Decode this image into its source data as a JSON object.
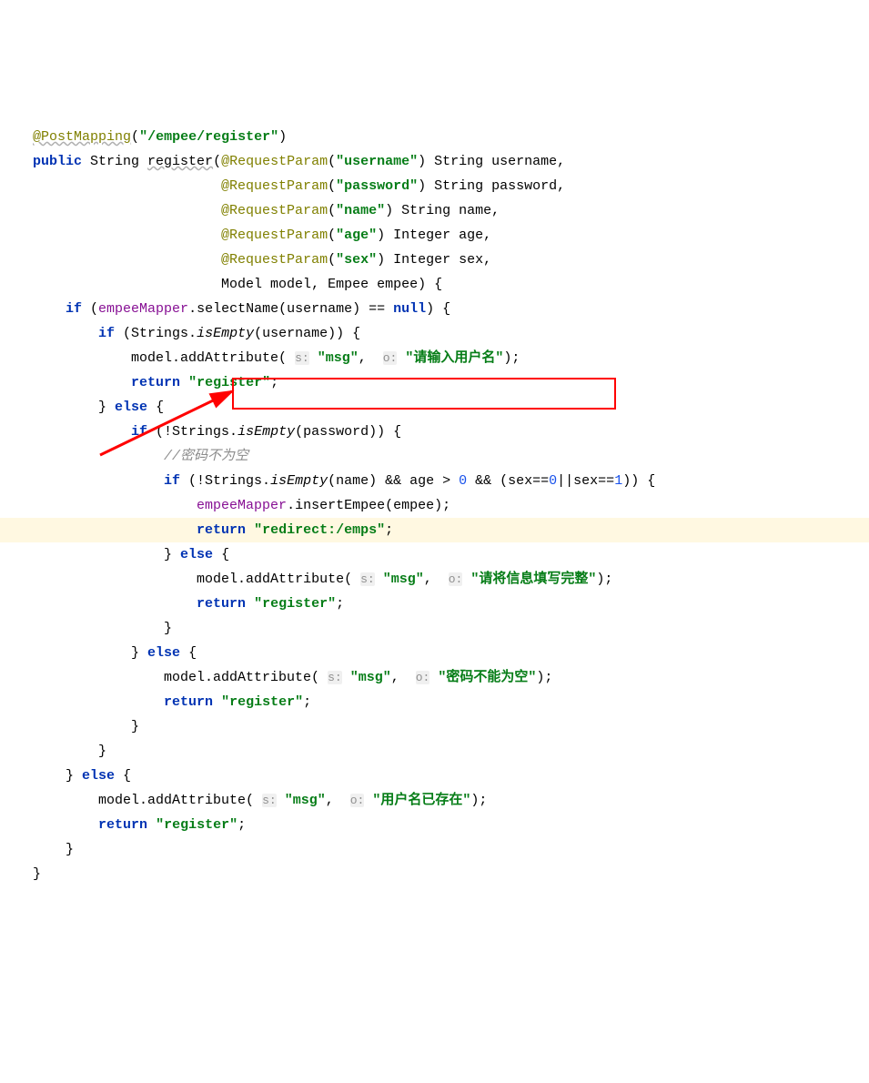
{
  "line1": {
    "ann": "@PostMapping",
    "p1": "(",
    "s": "\"/empee/register\"",
    "p2": ")"
  },
  "line2": {
    "kw1": "public",
    "sp1": " String ",
    "m": "register",
    "p1": "(",
    "ann": "@RequestParam",
    "p2": "(",
    "s": "\"username\"",
    "p3": ") String username,"
  },
  "line3": {
    "ann": "@RequestParam",
    "p1": "(",
    "s": "\"password\"",
    "p2": ") String password,"
  },
  "line4": {
    "ann": "@RequestParam",
    "p1": "(",
    "s": "\"name\"",
    "p2": ") String name,"
  },
  "line5": {
    "ann": "@RequestParam",
    "p1": "(",
    "s": "\"age\"",
    "p2": ") Integer age,"
  },
  "line6": {
    "ann": "@RequestParam",
    "p1": "(",
    "s": "\"sex\"",
    "p2": ") Integer sex,"
  },
  "line7": {
    "txt": "Model model, Empee empee) {"
  },
  "line8": {
    "kw": "if",
    "p1": " (",
    "f": "empeeMapper",
    "p2": ".selectName(username) == ",
    "kw2": "null",
    "p3": ") {"
  },
  "line9": {
    "kw": "if",
    "p1": " (Strings.",
    "m": "isEmpty",
    "p2": "(username)) {"
  },
  "line10": {
    "p1": "model.addAttribute( ",
    "h1": "s:",
    "sp1": " ",
    "s1": "\"msg\"",
    "p2": ",  ",
    "h2": "o:",
    "sp2": " ",
    "s2": "\"请输入用户名\"",
    "p3": ");"
  },
  "line11": {
    "kw": "return",
    "sp": " ",
    "s": "\"register\"",
    "p": ";"
  },
  "line12": {
    "p": "} ",
    "kw": "else",
    "p2": " {"
  },
  "line13": {
    "kw": "if",
    "p1": " (!Strings.",
    "m": "isEmpty",
    "p2": "(password)) {"
  },
  "line14": {
    "c": "//密码不为空"
  },
  "line15": {
    "kw": "if",
    "p1": " (!Strings.",
    "m": "isEmpty",
    "p2": "(name) && age > ",
    "n1": "0",
    "p3": " && (sex==",
    "n2": "0",
    "p4": "||sex==",
    "n3": "1",
    "p5": ")) {"
  },
  "line16": {
    "f": "empeeMapper",
    "p": ".insertEmpee(empee);"
  },
  "line17": {
    "kw": "return",
    "sp": " ",
    "s": "\"redirect:/emps\"",
    "p": ";"
  },
  "line18": {
    "p": "} ",
    "kw": "else",
    "p2": " {"
  },
  "line19": {
    "p1": "model.addAttribute( ",
    "h1": "s:",
    "sp1": " ",
    "s1": "\"msg\"",
    "p2": ",  ",
    "h2": "o:",
    "sp2": " ",
    "s2": "\"请将信息填写完整\"",
    "p3": ");"
  },
  "line20": {
    "kw": "return",
    "sp": " ",
    "s": "\"register\"",
    "p": ";"
  },
  "line21": {
    "p": "}"
  },
  "line22": {
    "p": "} ",
    "kw": "else",
    "p2": " {"
  },
  "line23": {
    "p1": "model.addAttribute( ",
    "h1": "s:",
    "sp1": " ",
    "s1": "\"msg\"",
    "p2": ",  ",
    "h2": "o:",
    "sp2": " ",
    "s2": "\"密码不能为空\"",
    "p3": ");"
  },
  "line24": {
    "kw": "return",
    "sp": " ",
    "s": "\"register\"",
    "p": ";"
  },
  "line25": {
    "p": "}"
  },
  "line26": {
    "p": "}"
  },
  "line27": {
    "p": "} ",
    "kw": "else",
    "p2": " {"
  },
  "line28": {
    "p1": "model.addAttribute( ",
    "h1": "s:",
    "sp1": " ",
    "s1": "\"msg\"",
    "p2": ",  ",
    "h2": "o:",
    "sp2": " ",
    "s2": "\"用户名已存在\"",
    "p3": ");"
  },
  "line29": {
    "kw": "return",
    "sp": " ",
    "s": "\"register\"",
    "p": ";"
  },
  "line30": {
    "p": "}"
  },
  "line31": {
    "p": "}"
  }
}
